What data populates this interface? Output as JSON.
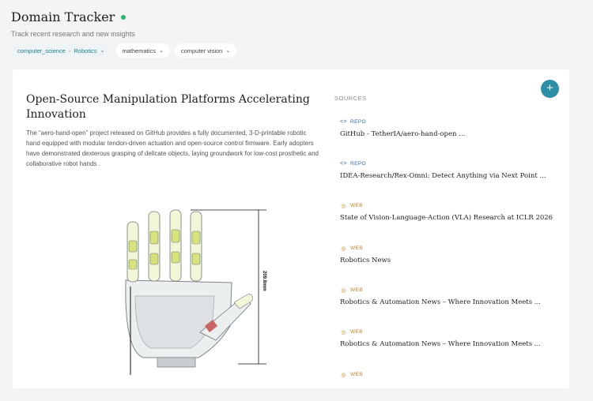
{
  "app": {
    "title": "Domain Tracker",
    "subtitle": "Track recent research and new insights",
    "status_color": "#2fb36b",
    "accent_color": "#2c8fa6"
  },
  "filters": {
    "domain": "computer_science",
    "subdomain": "Robotics",
    "chips": [
      "mathematics",
      "computer vision"
    ]
  },
  "article": {
    "title": "Open-Source Manipulation Platforms Accelerating Innovation",
    "body": "The “aero-hand-open” project released on GitHub provides a fully documented, 3-D-printable robotic hand equipped with modular tendon-driven actuation and open-source control firmware. Early adopters have demonstrated dexterous grasping of delicate objects, laying groundwork for low-cost prosthetic and collaborative robot hands .",
    "figure_label": "209.8mm"
  },
  "sources": {
    "label": "SOURCES",
    "add_label": "+",
    "items": [
      {
        "type": "REPO",
        "icon": "code-icon",
        "title": "GitHub - TetherIA/aero-hand-open ..."
      },
      {
        "type": "REPO",
        "icon": "code-icon",
        "title": "IDEA-Research/Rex-Omni: Detect Anything via Next Point ..."
      },
      {
        "type": "WEB",
        "icon": "globe-icon",
        "title": "State of Vision-Language-Action (VLA) Research at ICLR 2026"
      },
      {
        "type": "WEB",
        "icon": "globe-icon",
        "title": "Robotics News"
      },
      {
        "type": "WEB",
        "icon": "globe-icon",
        "title": "Robotics & Automation News – Where Innovation Meets ..."
      },
      {
        "type": "WEB",
        "icon": "globe-icon",
        "title": "Robotics & Automation News – Where Innovation Meets ..."
      },
      {
        "type": "WEB",
        "icon": "globe-icon",
        "title": ""
      }
    ]
  }
}
